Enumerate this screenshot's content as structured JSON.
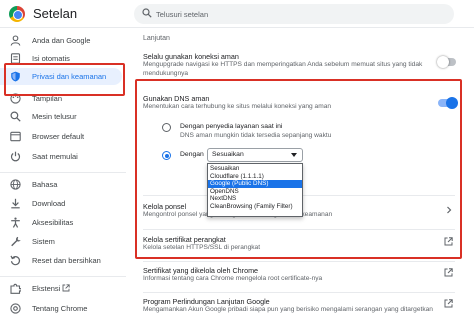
{
  "header": {
    "app_title": "Setelan",
    "search_placeholder": "Telusuri setelan"
  },
  "sidebar": {
    "items": [
      {
        "label": "Anda dan Google",
        "icon": "person-icon"
      },
      {
        "label": "Isi otomatis",
        "icon": "document-icon"
      },
      {
        "label": "Privasi dan keamanan",
        "icon": "shield-icon"
      },
      {
        "label": "Tampilan",
        "icon": "palette-icon"
      },
      {
        "label": "Mesin telusur",
        "icon": "search-icon"
      },
      {
        "label": "Browser default",
        "icon": "browser-icon"
      },
      {
        "label": "Saat memulai",
        "icon": "power-icon"
      },
      {
        "label": "Bahasa",
        "icon": "globe-icon"
      },
      {
        "label": "Download",
        "icon": "download-icon"
      },
      {
        "label": "Aksesibilitas",
        "icon": "accessibility-icon"
      },
      {
        "label": "Sistem",
        "icon": "wrench-icon"
      },
      {
        "label": "Reset dan bersihkan",
        "icon": "reset-icon"
      },
      {
        "label": "Ekstensi",
        "icon": "puzzle-icon"
      },
      {
        "label": "Tentang Chrome",
        "icon": "chrome-icon"
      }
    ]
  },
  "main": {
    "section_heading": "Lanjutan",
    "secure_connection": {
      "title": "Selalu gunakan koneksi aman",
      "subtitle": "Mengupgrade navigasi ke HTTPS dan memperingatkan Anda sebelum memuat situs yang tidak mendukungnya",
      "enabled": false
    },
    "secure_dns": {
      "title": "Gunakan DNS aman",
      "subtitle": "Menentukan cara terhubung ke situs melalui koneksi yang aman",
      "enabled": true,
      "option_current": {
        "title": "Dengan penyedia layanan saat ini",
        "subtitle": "DNS aman mungkin tidak tersedia sepanjang waktu"
      },
      "option_custom": {
        "label": "Dengan",
        "selected_value": "Sesuaikan",
        "options": [
          "Sesuaikan",
          "Cloudflare (1.1.1.1)",
          "Google (Public DNS)",
          "OpenDNS",
          "NextDNS",
          "CleanBrowsing (Family Filter)"
        ],
        "highlighted_index": 2
      }
    },
    "phone_keys": {
      "title": "Kelola ponsel",
      "subtitle": "Mengontrol ponsel yang Anda gunakan sebagai kunci keamanan"
    },
    "certs": {
      "title": "Kelola sertifikat perangkat",
      "subtitle": "Kelola setelan HTTPS/SSL di perangkat"
    },
    "chrome_certs": {
      "title": "Sertifikat yang dikelola oleh Chrome",
      "subtitle": "Informasi tentang cara Chrome mengelola root certificate-nya"
    },
    "advanced_protection": {
      "title": "Program Perlindungan Lanjutan Google",
      "subtitle": "Mengamankan Akun Google pribadi siapa pun yang berisiko mengalami serangan yang ditargetkan"
    }
  },
  "colors": {
    "accent": "#1a73e8",
    "highlight_box": "#d93025",
    "active_nav_bg": "#e8f0fe"
  }
}
